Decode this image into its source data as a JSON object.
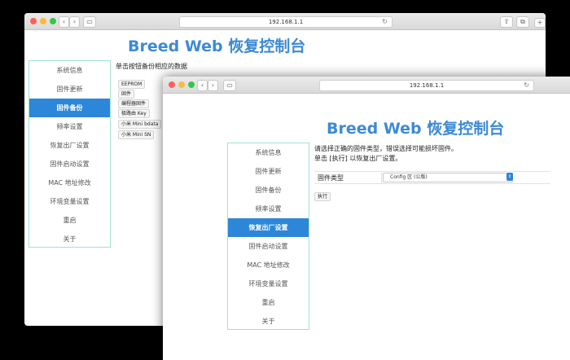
{
  "back_window": {
    "url": "192.168.1.1",
    "title": "Breed Web 恢复控制台",
    "instruction": "单击按钮备份相应的数据",
    "backup_buttons": [
      "EEPROM",
      "固件",
      "编程器固件",
      "极路由 Key",
      "小米 Mini bdata",
      "小米 Mini SN"
    ]
  },
  "front_window": {
    "url": "192.168.1.1",
    "title": "Breed Web 恢复控制台",
    "instruction_line1": "请选择正确的固件类型，错误选择可能损坏固件。",
    "instruction_line2": "单击 [执行] 以恢复出厂设置。",
    "firmware_type_label": "固件类型",
    "firmware_type_value": "Config 区 (公版)",
    "execute_label": "执行"
  },
  "menu": {
    "items": [
      "系统信息",
      "固件更新",
      "固件备份",
      "频率设置",
      "恢复出厂设置",
      "固件启动设置",
      "MAC 地址修改",
      "环境变量设置",
      "重启",
      "关于"
    ],
    "back_active_index": 2,
    "front_active_index": 4
  },
  "colors": {
    "accent": "#2d87d9",
    "title": "#3c8ad6",
    "menu_border": "#9fe3d0"
  },
  "icons": [
    "chevron-left-icon",
    "chevron-right-icon",
    "sidebar-icon",
    "reload-icon",
    "share-icon",
    "tabs-icon",
    "new-tab-icon",
    "dropdown-arrow-icon"
  ]
}
